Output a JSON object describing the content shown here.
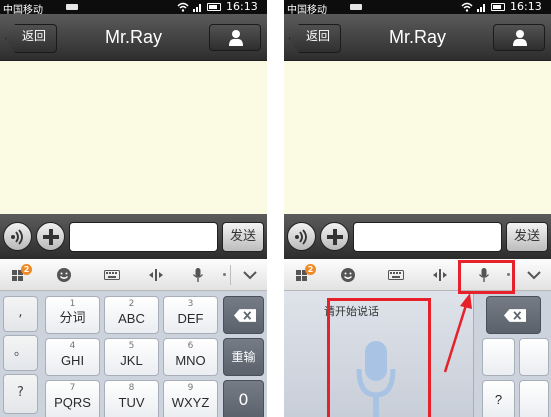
{
  "screens": [
    {
      "status": {
        "carrier": "中国移动",
        "time": "16:13"
      },
      "header": {
        "back_label": "返回",
        "title": "Mr.Ray"
      },
      "input_bar": {
        "send_label": "发送",
        "placeholder": ""
      },
      "keyboard": {
        "side_keys": [
          ",",
          "。",
          "?"
        ],
        "rows": [
          [
            {
              "main": "分词",
              "sub": "1"
            },
            {
              "main": "ABC",
              "sub": "2"
            },
            {
              "main": "DEF",
              "sub": "3"
            }
          ],
          [
            {
              "main": "GHI",
              "sub": "4"
            },
            {
              "main": "JKL",
              "sub": "5"
            },
            {
              "main": "MNO",
              "sub": "6"
            }
          ],
          [
            {
              "main": "PQRS",
              "sub": "7"
            },
            {
              "main": "TUV",
              "sub": "8"
            },
            {
              "main": "WXYZ",
              "sub": "9"
            }
          ]
        ],
        "reinput_label": "重输",
        "zero_label": "0"
      },
      "toolbar": {
        "badge": "2"
      }
    },
    {
      "status": {
        "carrier": "中国移动",
        "time": "16:13"
      },
      "header": {
        "back_label": "返回",
        "title": "Mr.Ray"
      },
      "input_bar": {
        "send_label": "发送",
        "placeholder": ""
      },
      "voice_panel": {
        "prompt": "请开始说话"
      },
      "side_keys": [
        "?"
      ],
      "toolbar": {
        "badge": "2"
      }
    }
  ],
  "colors": {
    "highlight": "#e6212a",
    "accent": "#f08a25",
    "mic": "#a8c3e3"
  }
}
